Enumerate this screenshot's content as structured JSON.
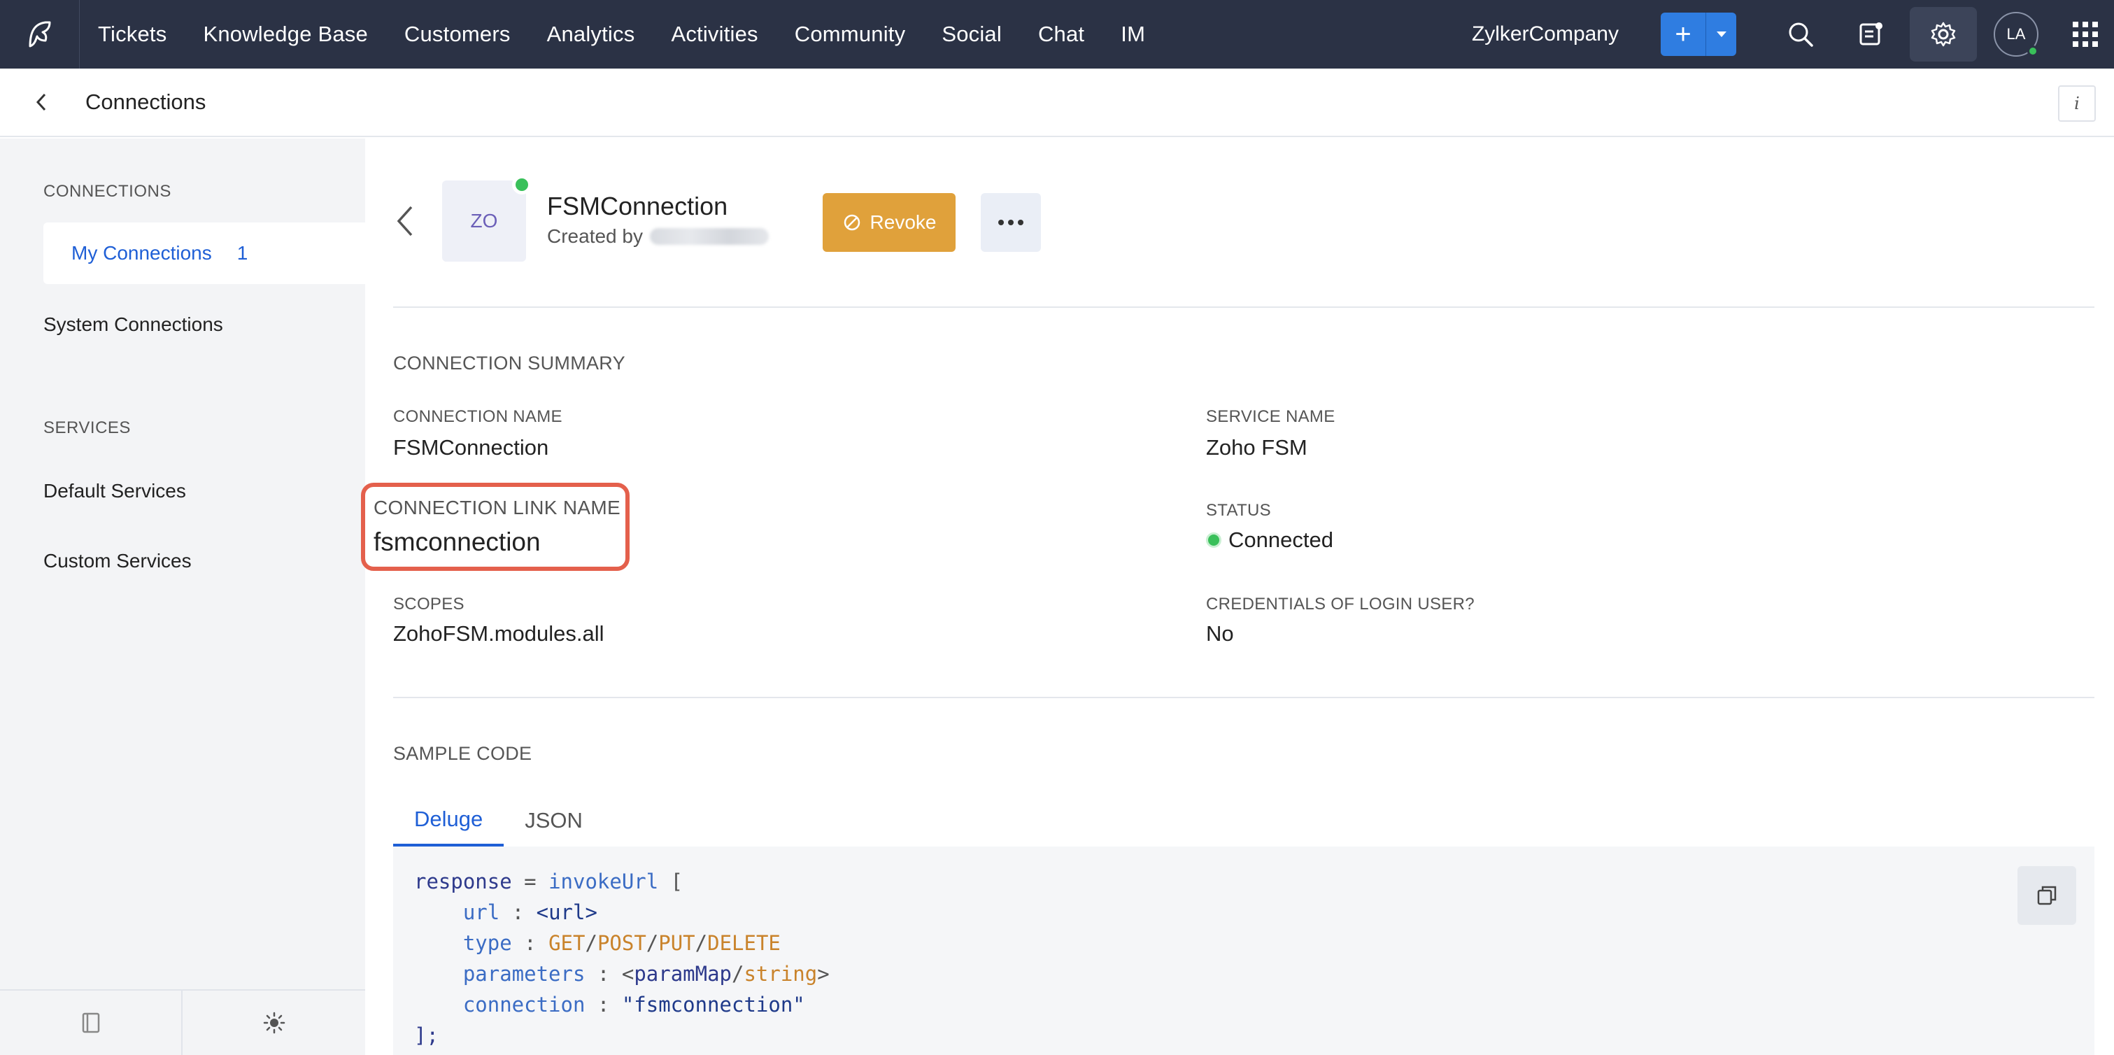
{
  "topnav": {
    "items": [
      "Tickets",
      "Knowledge Base",
      "Customers",
      "Analytics",
      "Activities",
      "Community",
      "Social",
      "Chat",
      "IM"
    ],
    "company": "ZylkerCompany",
    "add_label": "+",
    "avatar_initials": "LA"
  },
  "subheader": {
    "title": "Connections",
    "info_label": "i"
  },
  "sidebar": {
    "connections_heading": "CONNECTIONS",
    "my_connections_label": "My Connections",
    "my_connections_count": "1",
    "system_connections_label": "System Connections",
    "services_heading": "SERVICES",
    "default_services_label": "Default Services",
    "custom_services_label": "Custom Services"
  },
  "connection": {
    "avatar_initials": "ZO",
    "title": "FSMConnection",
    "created_by_label": "Created by",
    "revoke_label": "Revoke"
  },
  "summary": {
    "section_title": "CONNECTION SUMMARY",
    "connection_name_label": "CONNECTION NAME",
    "connection_name_value": "FSMConnection",
    "service_name_label": "SERVICE NAME",
    "service_name_value": "Zoho FSM",
    "link_name_label": "CONNECTION LINK NAME",
    "link_name_value": "fsmconnection",
    "status_label": "STATUS",
    "status_value": "Connected",
    "scopes_label": "SCOPES",
    "scopes_value": "ZohoFSM.modules.all",
    "credentials_label": "CREDENTIALS OF LOGIN USER?",
    "credentials_value": "No"
  },
  "sample_code": {
    "section_title": "SAMPLE CODE",
    "tabs": [
      "Deluge",
      "JSON"
    ],
    "line1": {
      "var": "response",
      "op": " = ",
      "fn": "invokeUrl",
      "bracket": " ["
    },
    "line2": {
      "key": "url",
      "sep": " : ",
      "val": "<url>"
    },
    "line3": {
      "key": "type",
      "sep": " : ",
      "v1": "GET",
      "v2": "POST",
      "v3": "PUT",
      "v4": "DELETE",
      "slash": "/"
    },
    "line4": {
      "key": "parameters",
      "sep": " : ",
      "lt": "<",
      "v1": "paramMap",
      "slash": "/",
      "v2": "string",
      "gt": ">"
    },
    "line5": {
      "key": "connection",
      "sep": " : ",
      "val": "\"fsmconnection\""
    },
    "line6": "];"
  },
  "colors": {
    "nav_bg": "#2b3245",
    "accent_blue": "#2f7de1",
    "revoke_orange": "#e0a13b",
    "status_green": "#39c05a",
    "highlight_red": "#e4604c"
  }
}
